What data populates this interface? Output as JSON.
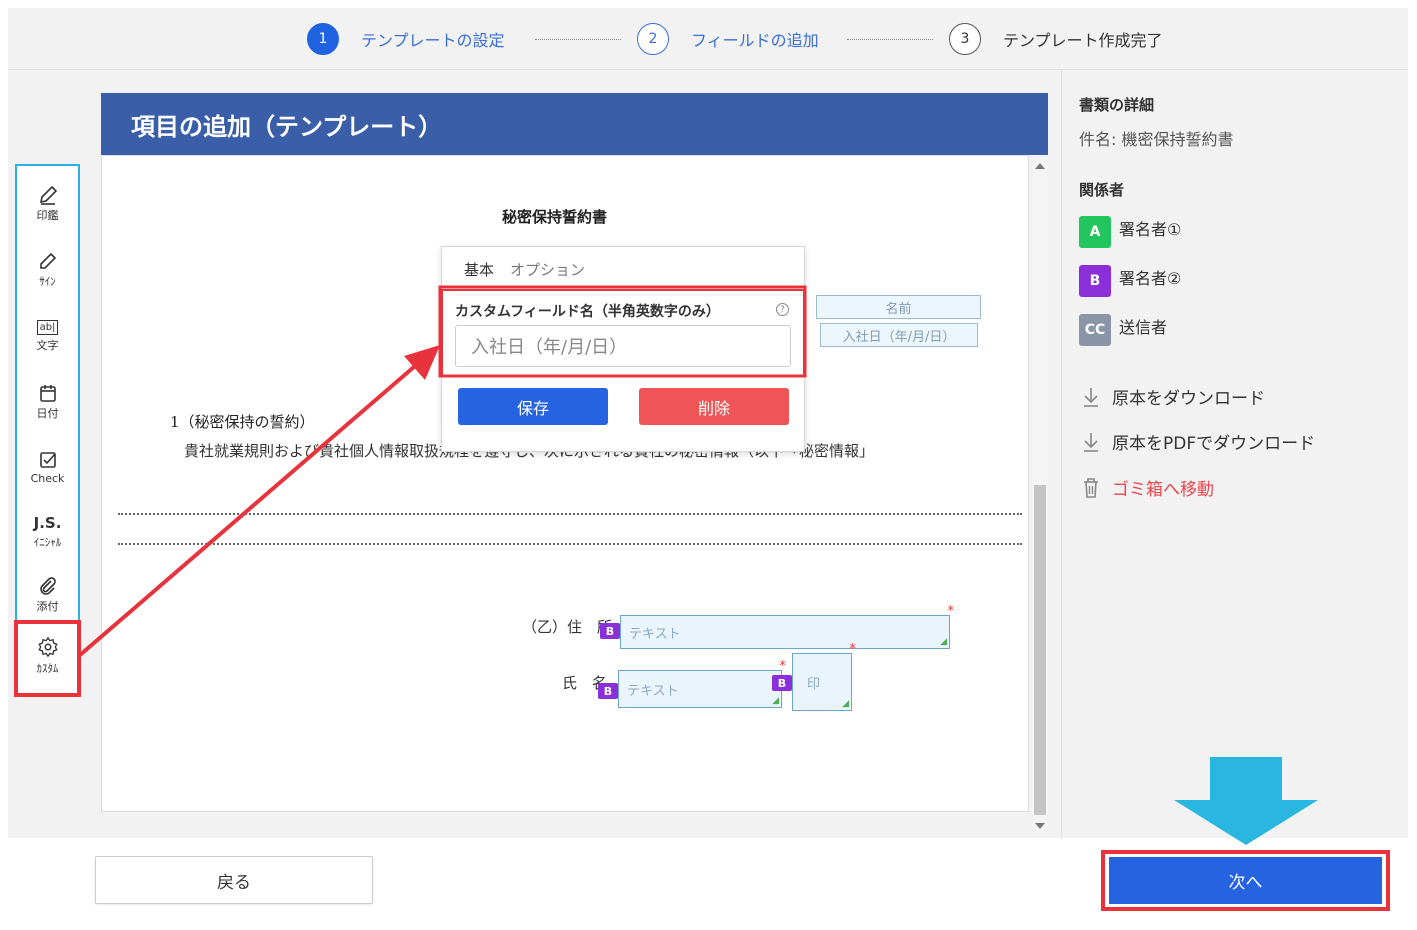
{
  "stepper": {
    "steps": [
      {
        "number": "1",
        "label": "テンプレートの設定",
        "state": "active"
      },
      {
        "number": "2",
        "label": "フィールドの追加",
        "state": "current"
      },
      {
        "number": "3",
        "label": "テンプレート作成完了",
        "state": "pending"
      }
    ]
  },
  "toolbar": {
    "items": [
      {
        "label": "印鑑",
        "icon": "pen-nib-icon"
      },
      {
        "label": "ｻｲﾝ",
        "icon": "pencil-icon"
      },
      {
        "label": "文字",
        "icon": "text-box-icon",
        "glyph": "ab|"
      },
      {
        "label": "日付",
        "icon": "calendar-icon"
      },
      {
        "label": "Check",
        "icon": "checkbox-icon"
      },
      {
        "label": "ｲﾆｼｬﾙ",
        "icon": "initials-icon",
        "glyph": "J.S."
      },
      {
        "label": "添付",
        "icon": "paperclip-icon"
      },
      {
        "label": "ｶｽﾀﾑ",
        "icon": "gear-icon"
      }
    ]
  },
  "editor": {
    "header": "項目の追加（テンプレート）",
    "doc_title": "秘密保持誓約書",
    "section": "1（秘密保持の誓約）",
    "paragraph": "貴社就業規則および貴社個人情報取扱規程を遵守し、次に示される貴社の秘密情報（以下「秘密情報」",
    "address_label": "（乙）住　所",
    "name_label": "氏　名",
    "fields": {
      "name_placeholder": "名前",
      "date_placeholder": "入社日（年/月/日）",
      "text_placeholder": "テキスト",
      "seal_placeholder": "印",
      "signer_badge": "B",
      "required_mark": "*"
    }
  },
  "popup": {
    "tabs": [
      "基本",
      "オプション"
    ],
    "field_label": "カスタムフィールド名（半角英数字のみ）",
    "help_icon": "?",
    "input_value": "入社日（年/月/日）",
    "save_label": "保存",
    "delete_label": "削除"
  },
  "details": {
    "heading": "書類の詳細",
    "subject": "件名: 機密保持誓約書",
    "parties_heading": "関係者",
    "parties": [
      {
        "badge": "A",
        "name": "署名者①",
        "color": "#22c55e"
      },
      {
        "badge": "B",
        "name": "署名者②",
        "color": "#8b2fd8"
      },
      {
        "badge": "CC",
        "name": "送信者",
        "color": "#8a96a8"
      }
    ],
    "actions": [
      {
        "label": "原本をダウンロード",
        "icon": "download-icon"
      },
      {
        "label": "原本をPDFでダウンロード",
        "icon": "download-icon"
      },
      {
        "label": "ゴミ箱へ移動",
        "icon": "trash-icon",
        "color": "#e9454d"
      }
    ]
  },
  "footer": {
    "back_label": "戻る",
    "next_label": "次へ"
  },
  "colors": {
    "primary": "#2563e0",
    "header": "#3a5ea8",
    "highlight": "#e8323c",
    "annotation_arrow": "#29b6e0"
  }
}
